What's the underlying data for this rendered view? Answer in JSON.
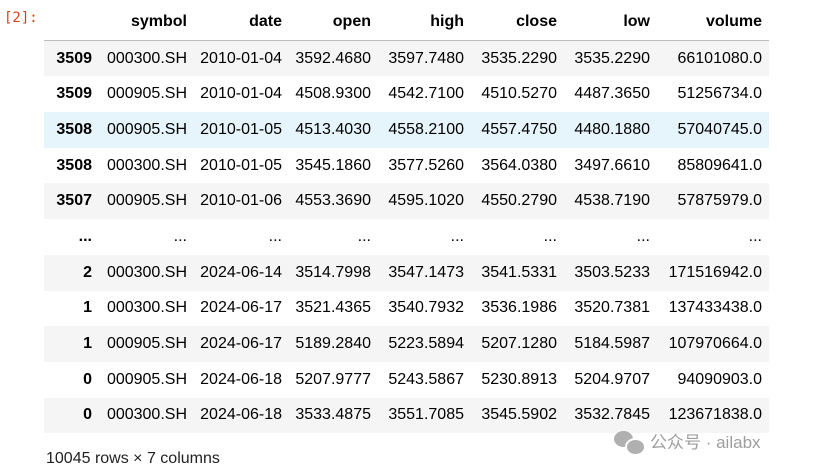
{
  "cell": {
    "prompt": "[2]:"
  },
  "dataframe": {
    "columns": [
      "",
      "symbol",
      "date",
      "open",
      "high",
      "close",
      "low",
      "volume"
    ],
    "rows": [
      {
        "index": "3509",
        "symbol": "000300.SH",
        "date": "2010-01-04",
        "open": "3592.4680",
        "high": "3597.7480",
        "close": "3535.2290",
        "low": "3535.2290",
        "volume": "66101080.0"
      },
      {
        "index": "3509",
        "symbol": "000905.SH",
        "date": "2010-01-04",
        "open": "4508.9300",
        "high": "4542.7100",
        "close": "4510.5270",
        "low": "4487.3650",
        "volume": "51256734.0"
      },
      {
        "index": "3508",
        "symbol": "000905.SH",
        "date": "2010-01-05",
        "open": "4513.4030",
        "high": "4558.2100",
        "close": "4557.4750",
        "low": "4480.1880",
        "volume": "57040745.0"
      },
      {
        "index": "3508",
        "symbol": "000300.SH",
        "date": "2010-01-05",
        "open": "3545.1860",
        "high": "3577.5260",
        "close": "3564.0380",
        "low": "3497.6610",
        "volume": "85809641.0"
      },
      {
        "index": "3507",
        "symbol": "000905.SH",
        "date": "2010-01-06",
        "open": "4553.3690",
        "high": "4595.1020",
        "close": "4550.2790",
        "low": "4538.7190",
        "volume": "57875979.0"
      },
      {
        "index": "...",
        "symbol": "...",
        "date": "...",
        "open": "...",
        "high": "...",
        "close": "...",
        "low": "...",
        "volume": "..."
      },
      {
        "index": "2",
        "symbol": "000300.SH",
        "date": "2024-06-14",
        "open": "3514.7998",
        "high": "3547.1473",
        "close": "3541.5331",
        "low": "3503.5233",
        "volume": "171516942.0"
      },
      {
        "index": "1",
        "symbol": "000300.SH",
        "date": "2024-06-17",
        "open": "3521.4365",
        "high": "3540.7932",
        "close": "3536.1986",
        "low": "3520.7381",
        "volume": "137433438.0"
      },
      {
        "index": "1",
        "symbol": "000905.SH",
        "date": "2024-06-17",
        "open": "5189.2840",
        "high": "5223.5894",
        "close": "5207.1280",
        "low": "5184.5987",
        "volume": "107970664.0"
      },
      {
        "index": "0",
        "symbol": "000905.SH",
        "date": "2024-06-18",
        "open": "5207.9777",
        "high": "5243.5867",
        "close": "5230.8913",
        "low": "5204.9707",
        "volume": "94090903.0"
      },
      {
        "index": "0",
        "symbol": "000300.SH",
        "date": "2024-06-18",
        "open": "3533.4875",
        "high": "3551.7085",
        "close": "3545.5902",
        "low": "3532.7845",
        "volume": "123671838.0"
      }
    ],
    "hovered_row": 2,
    "summary": "10045 rows × 7 columns"
  },
  "watermark": {
    "icon": "wechat-icon",
    "text": "公众号 · ailabx"
  },
  "colors": {
    "prompt": "#d84315",
    "row_stripe": "#f5f5f5",
    "row_hover": "#e6f4fb"
  }
}
